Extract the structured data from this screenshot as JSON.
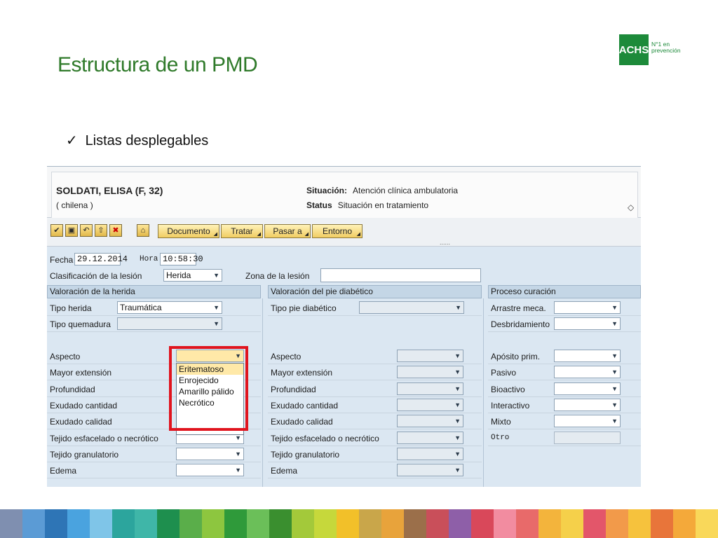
{
  "slide": {
    "title": "Estructura de un PMD",
    "bullet": "Listas desplegables",
    "logo": {
      "brand": "ACHS",
      "tagline1": "N°1 en",
      "tagline2": "prevención"
    }
  },
  "patient": {
    "name": "SOLDATI, ELISA (F, 32)",
    "nationality": "( chilena )",
    "situacion_label": "Situación:",
    "situacion_value": "Atención clínica ambulatoria",
    "status_label": "Status",
    "status_value": "Situación en tratamiento"
  },
  "toolbar": {
    "buttons": [
      "Documento",
      "Tratar",
      "Pasar a",
      "Entorno"
    ]
  },
  "form": {
    "fecha_label": "Fecha",
    "fecha_value": "29.12.2014",
    "hora_label": "Hora",
    "hora_value": "10:58:30",
    "clasificacion_label": "Clasificación de la lesión",
    "clasificacion_value": "Herida",
    "zona_label": "Zona de la lesión",
    "zona_value": ""
  },
  "sections": {
    "herida": {
      "title": "Valoración de la herida",
      "tipo_herida_label": "Tipo herida",
      "tipo_herida_value": "Traumática",
      "tipo_quemadura_label": "Tipo quemadura",
      "rows": [
        "Aspecto",
        "Mayor extensión",
        "Profundidad",
        "Exudado cantidad",
        "Exudado calidad",
        "Tejido esfacelado o necrótico",
        "Tejido granulatorio",
        "Edema"
      ]
    },
    "pie": {
      "title": "Valoración del pie diabético",
      "tipo_pie_label": "Tipo pie diabético",
      "rows": [
        "Aspecto",
        "Mayor extensión",
        "Profundidad",
        "Exudado cantidad",
        "Exudado calidad",
        "Tejido esfacelado o necrótico",
        "Tejido granulatorio",
        "Edema"
      ]
    },
    "curacion": {
      "title": "Proceso curación",
      "arrastre_label": "Arrastre meca.",
      "desbridamiento_label": "Desbridamiento",
      "rows": [
        "Apósito prim.",
        "Pasivo",
        "Bioactivo",
        "Interactivo",
        "Mixto",
        "Otro"
      ]
    }
  },
  "dropdown_options": [
    "Eritematoso",
    "Enrojecido",
    "Amarillo pálido",
    "Necrótico"
  ],
  "colors": {
    "title": "#2f7a2a",
    "highlight": "#e0141e",
    "brand": "#1d8a3a"
  }
}
